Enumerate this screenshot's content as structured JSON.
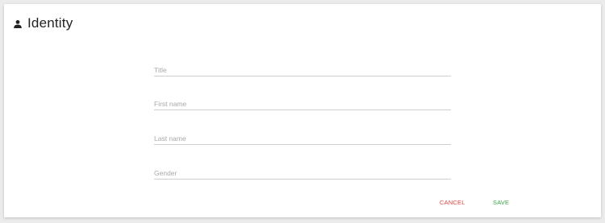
{
  "header": {
    "icon": "person-icon",
    "title": "Identity"
  },
  "form": {
    "fields": [
      {
        "name": "title",
        "placeholder": "Title",
        "value": ""
      },
      {
        "name": "first_name",
        "placeholder": "First name",
        "value": ""
      },
      {
        "name": "last_name",
        "placeholder": "Last name",
        "value": ""
      },
      {
        "name": "gender",
        "placeholder": "Gender",
        "value": ""
      }
    ]
  },
  "actions": {
    "cancel_label": "CANCEL",
    "save_label": "SAVE"
  },
  "colors": {
    "cancel": "#e0443c",
    "save": "#3aa84a",
    "background": "#ebebeb",
    "card": "#ffffff"
  }
}
